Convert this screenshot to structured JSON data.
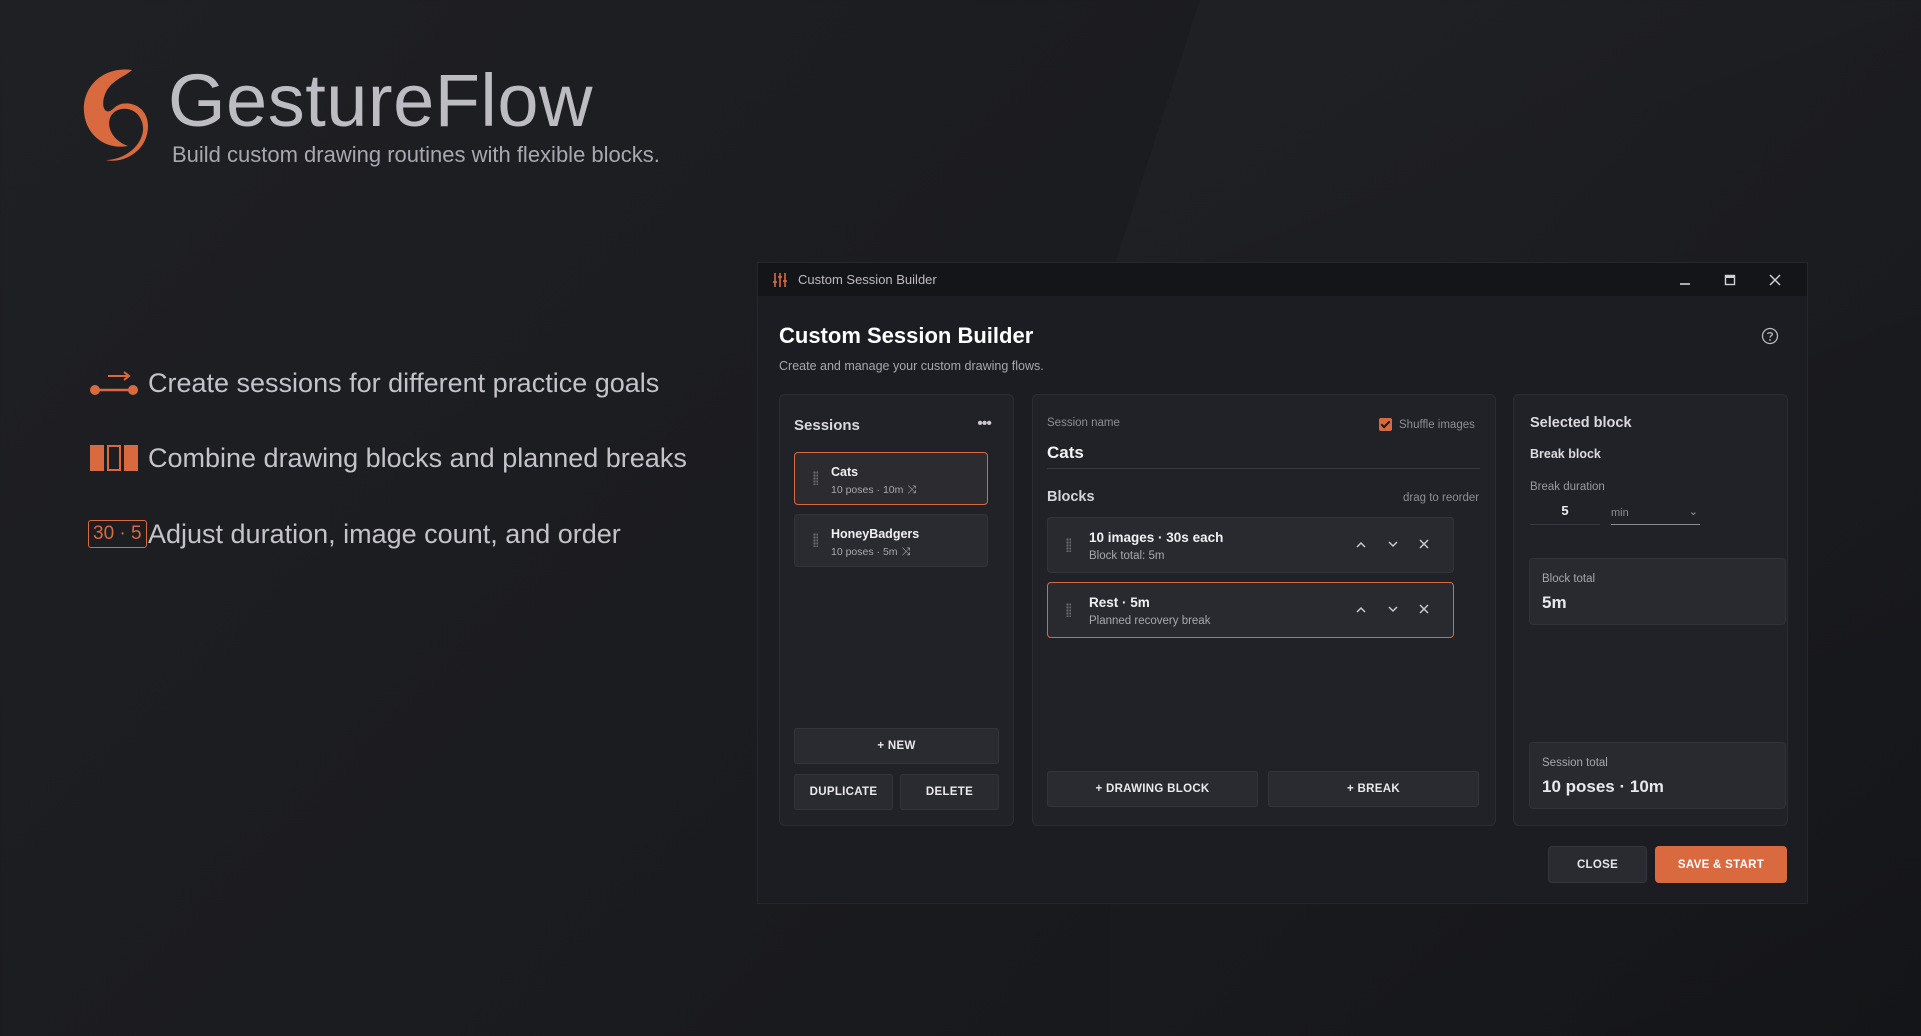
{
  "colors": {
    "accent": "#d96a3f",
    "background": "#1c1d22",
    "panel": "#212228"
  },
  "hero": {
    "brand_name": "GestureFlow",
    "tagline": "Build custom drawing routines with flexible blocks.",
    "features": [
      {
        "icon": "flow-arrow-icon",
        "text": "Create sessions for different practice goals"
      },
      {
        "icon": "blocks-icon",
        "text": "Combine drawing blocks and planned breaks"
      },
      {
        "icon": "duration-badge-icon",
        "badge": "30 · 5",
        "text": "Adjust duration, image count, and order"
      }
    ]
  },
  "window": {
    "titlebar_title": "Custom Session Builder",
    "title": "Custom Session Builder",
    "subtitle": "Create and manage your custom drawing flows."
  },
  "sessions": {
    "heading": "Sessions",
    "items": [
      {
        "name": "Cats",
        "meta": "10 poses · 10m",
        "selected": true
      },
      {
        "name": "HoneyBadgers",
        "meta": "10 poses · 5m",
        "selected": false
      }
    ],
    "new_label": "+ NEW",
    "duplicate_label": "DUPLICATE",
    "delete_label": "DELETE"
  },
  "editor": {
    "session_name_label": "Session name",
    "session_name_value": "Cats",
    "shuffle_label": "Shuffle images",
    "shuffle_checked": true,
    "blocks_heading": "Blocks",
    "reorder_hint": "drag to reorder",
    "blocks": [
      {
        "title": "10 images · 30s each",
        "subtitle": "Block total: 5m",
        "selected": false
      },
      {
        "title": "Rest · 5m",
        "subtitle": "Planned recovery break",
        "selected": true
      }
    ],
    "add_drawing_label": "+ DRAWING BLOCK",
    "add_break_label": "+ BREAK"
  },
  "selected_block": {
    "heading": "Selected block",
    "type": "Break block",
    "duration_label": "Break duration",
    "duration_value": "5",
    "unit_value": "min",
    "block_total_label": "Block total",
    "block_total_value": "5m",
    "session_total_label": "Session total",
    "session_total_value": "10 poses · 10m"
  },
  "footer": {
    "close_label": "CLOSE",
    "save_label": "SAVE & START"
  }
}
